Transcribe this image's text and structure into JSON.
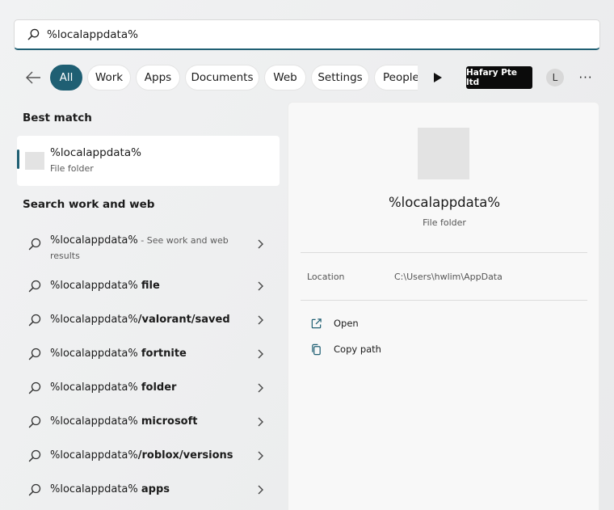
{
  "search": {
    "query": "%localappdata%",
    "placeholder": ""
  },
  "filters": {
    "chips": [
      {
        "label": "All",
        "active": true
      },
      {
        "label": "Work"
      },
      {
        "label": "Apps"
      },
      {
        "label": "Documents"
      },
      {
        "label": "Web"
      },
      {
        "label": "Settings"
      },
      {
        "label": "People"
      }
    ],
    "org_label": "Hafary Pte ltd",
    "avatar_initial": "L",
    "more_label": "···"
  },
  "best_match": {
    "title": "Best match",
    "name": "%localappdata%",
    "type": "File folder"
  },
  "web_results": {
    "title": "Search work and web",
    "items": [
      {
        "prefix": "%localappdata%",
        "bold": "",
        "hint": " - See work and web results"
      },
      {
        "prefix": "%localappdata% ",
        "bold": "file",
        "hint": ""
      },
      {
        "prefix": "%localappdata%",
        "bold": "/valorant/saved",
        "hint": ""
      },
      {
        "prefix": "%localappdata% ",
        "bold": "fortnite",
        "hint": ""
      },
      {
        "prefix": "%localappdata% ",
        "bold": "folder",
        "hint": ""
      },
      {
        "prefix": "%localappdata% ",
        "bold": "microsoft",
        "hint": ""
      },
      {
        "prefix": "%localappdata%",
        "bold": "/roblox/versions",
        "hint": ""
      },
      {
        "prefix": "%localappdata% ",
        "bold": "apps",
        "hint": ""
      }
    ]
  },
  "preview": {
    "name": "%localappdata%",
    "type": "File folder",
    "location_label": "Location",
    "location_value": "C:\\Users\\hwlim\\AppData",
    "actions": [
      {
        "label": "Open",
        "icon": "open-external-icon"
      },
      {
        "label": "Copy path",
        "icon": "copy-icon"
      }
    ]
  },
  "colors": {
    "accent": "#1f5f73",
    "badge_bg": "#0b0b0b"
  }
}
